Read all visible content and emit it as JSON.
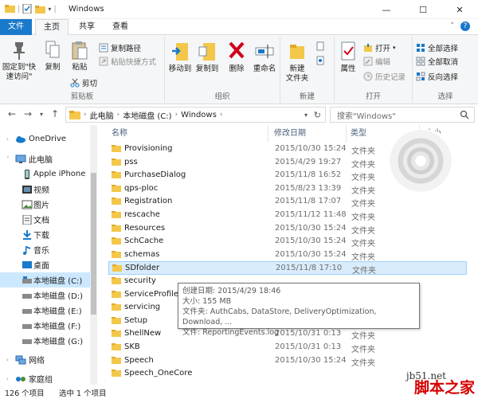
{
  "window": {
    "title": "Windows",
    "minimize": "—",
    "maximize": "☐",
    "close": "✕"
  },
  "ribbon_tabs": {
    "file": "文件",
    "home": "主页",
    "share": "共享",
    "view": "查看"
  },
  "ribbon": {
    "clipboard": {
      "pin": "固定到\"快\n速访问\"",
      "copy": "复制",
      "paste": "粘贴",
      "copy_path": "复制路径",
      "paste_shortcut": "粘贴快捷方式",
      "cut": "剪切",
      "label": "剪贴板"
    },
    "organize": {
      "move_to": "移动到",
      "copy_to": "复制到",
      "delete": "删除",
      "rename": "重命名",
      "label": "组织"
    },
    "new": {
      "new_folder": "新建\n文件夹",
      "label": "新建"
    },
    "open": {
      "properties": "属性",
      "open": "打开",
      "edit": "编辑",
      "history": "历史记录",
      "label": "打开"
    },
    "select": {
      "select_all": "全部选择",
      "select_none": "全部取消",
      "invert": "反向选择",
      "label": "选择"
    }
  },
  "address": {
    "crumbs": [
      "此电脑",
      "本地磁盘 (C:)",
      "Windows"
    ],
    "search_placeholder": "搜索\"Windows\""
  },
  "nav": [
    {
      "label": "OneDrive",
      "icon": "cloud-icon"
    },
    {
      "label": "此电脑",
      "icon": "computer-icon"
    },
    {
      "label": "Apple iPhone",
      "icon": "phone-icon"
    },
    {
      "label": "视频",
      "icon": "video-icon"
    },
    {
      "label": "图片",
      "icon": "picture-icon"
    },
    {
      "label": "文档",
      "icon": "document-icon"
    },
    {
      "label": "下载",
      "icon": "download-icon"
    },
    {
      "label": "音乐",
      "icon": "music-icon"
    },
    {
      "label": "桌面",
      "icon": "desktop-icon"
    },
    {
      "label": "本地磁盘 (C:)",
      "icon": "drive-icon"
    },
    {
      "label": "本地磁盘 (D:)",
      "icon": "drive-icon"
    },
    {
      "label": "本地磁盘 (E:)",
      "icon": "drive-icon"
    },
    {
      "label": "本地磁盘 (F:)",
      "icon": "drive-icon"
    },
    {
      "label": "本地磁盘 (G:)",
      "icon": "drive-icon"
    },
    {
      "label": "网络",
      "icon": "network-icon"
    },
    {
      "label": "家庭组",
      "icon": "homegroup-icon"
    }
  ],
  "columns": {
    "name": "名称",
    "modified": "修改日期",
    "type": "类型",
    "size": "大小"
  },
  "files": [
    {
      "name": "Provisioning",
      "date": "2015/10/30 15:24",
      "type": "文件夹"
    },
    {
      "name": "pss",
      "date": "2015/4/29 19:27",
      "type": "文件夹"
    },
    {
      "name": "PurchaseDialog",
      "date": "2015/11/8 16:52",
      "type": "文件夹"
    },
    {
      "name": "qps-ploc",
      "date": "2015/8/23 13:39",
      "type": "文件夹"
    },
    {
      "name": "Registration",
      "date": "2015/11/8 17:07",
      "type": "文件夹"
    },
    {
      "name": "rescache",
      "date": "2015/11/12 11:48",
      "type": "文件夹"
    },
    {
      "name": "Resources",
      "date": "2015/10/30 15:24",
      "type": "文件夹"
    },
    {
      "name": "SchCache",
      "date": "2015/10/30 15:24",
      "type": "文件夹"
    },
    {
      "name": "schemas",
      "date": "2015/10/30 15:24",
      "type": "文件夹"
    },
    {
      "name": "SDfolder",
      "date": "2015/11/8 17:10",
      "type": "文件夹"
    },
    {
      "name": "security",
      "date": "",
      "type": ""
    },
    {
      "name": "ServiceProfiles",
      "date": "",
      "type": ""
    },
    {
      "name": "servicing",
      "date": "",
      "type": ""
    },
    {
      "name": "Setup",
      "date": "",
      "type": "文件夹"
    },
    {
      "name": "ShellNew",
      "date": "2015/10/31 0:13",
      "type": "文件夹"
    },
    {
      "name": "SKB",
      "date": "2015/10/31 0:13",
      "type": "文件夹"
    },
    {
      "name": "Speech",
      "date": "2015/10/30 15:24",
      "type": "文件夹"
    },
    {
      "name": "Speech_OneCore",
      "date": "",
      "type": ""
    }
  ],
  "tooltip": {
    "created": "创建日期: 2015/4/29 18:46",
    "size": "大小: 155 MB",
    "folders": "文件夹: AuthCabs, DataStore, DeliveryOptimization, Download, ...",
    "files": "文件: ReportingEvents.log"
  },
  "status": {
    "count": "126 个项目",
    "selected": "选中 1 个项目"
  },
  "watermark": {
    "url": "jb51.net",
    "brand": "脚本之家"
  },
  "colors": {
    "accent": "#1979ca",
    "folder": "#f3c74a",
    "selected": "#cce8ff"
  }
}
